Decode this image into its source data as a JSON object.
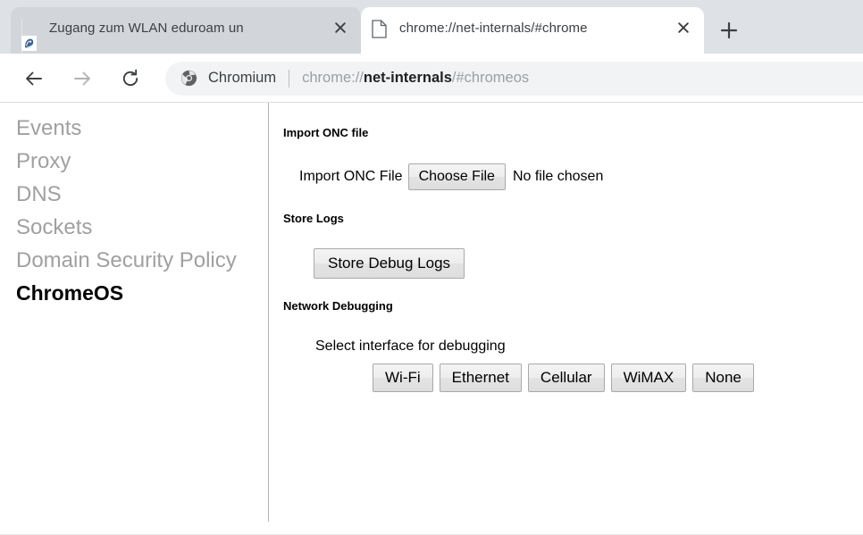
{
  "browser": {
    "tabs": [
      {
        "title": "Zugang zum WLAN eduroam un",
        "favicon": "crest-icon",
        "active": false,
        "close_label": "close-icon"
      },
      {
        "title": "chrome://net-internals/#chrome",
        "favicon": "document-icon",
        "active": true,
        "close_label": "close-icon"
      }
    ],
    "new_tab_label": "+",
    "toolbar": {
      "back_icon": "back-arrow-icon",
      "forward_icon": "forward-arrow-icon",
      "reload_icon": "reload-icon",
      "page_identity_icon": "chromium-icon",
      "security_label": "Chromium",
      "url_prefix": "chrome://",
      "url_strong": "net-internals",
      "url_suffix": "/#chromeos"
    },
    "colors": {
      "tabstrip_bg": "#dee1e6",
      "inactive_tab_bg": "#d2d6db",
      "active_tab_bg": "#ffffff",
      "omnibox_bg": "#f1f3f4",
      "url_muted": "#9aa0a6",
      "url_strong": "#202124",
      "sidebar_muted": "#a0a0a0",
      "sidebar_selected": "#000000"
    }
  },
  "sidebar": {
    "items": [
      {
        "label": "Events",
        "selected": false
      },
      {
        "label": "Proxy",
        "selected": false
      },
      {
        "label": "DNS",
        "selected": false
      },
      {
        "label": "Sockets",
        "selected": false
      },
      {
        "label": "Domain Security Policy",
        "selected": false
      },
      {
        "label": "ChromeOS",
        "selected": true
      }
    ]
  },
  "main": {
    "sections": [
      {
        "heading": "Import ONC file",
        "file_label": "Import ONC File",
        "file_button": "Choose File",
        "file_status": "No file chosen"
      },
      {
        "heading": "Store Logs",
        "store_button": "Store Debug Logs"
      },
      {
        "heading": "Network Debugging",
        "interface_label": "Select interface for debugging",
        "interface_buttons": [
          "Wi-Fi",
          "Ethernet",
          "Cellular",
          "WiMAX",
          "None"
        ]
      }
    ]
  }
}
